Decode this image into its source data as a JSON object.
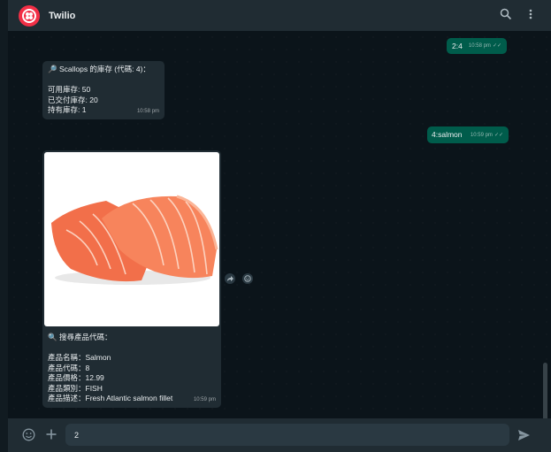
{
  "header": {
    "title": "Twilio"
  },
  "messages": {
    "m1": {
      "text": "2:4",
      "time": "10:58 pm"
    },
    "m2": {
      "text": "🔎 Scallops 的庫存 (代碼: 4)：\n\n可用庫存: 50\n已交付庫存: 20\n持有庫存: 1",
      "time": "10:58 pm"
    },
    "m3": {
      "text": "4:salmon",
      "time": "10:59 pm"
    },
    "m4": {
      "caption": "🔍 搜尋產品代碼：\n\n產品名稱：Salmon\n產品代碼：8\n產品價格：12.99\n產品類別：FISH\n產品描述：Fresh Atlantic salmon fillet",
      "time": "10:59 pm",
      "image": "salmon-fillet"
    }
  },
  "composer": {
    "value": "2"
  },
  "icons": {
    "header": [
      "search-icon",
      "menu-icon"
    ],
    "footer": [
      "emoji-icon",
      "plus-icon",
      "send-icon"
    ],
    "actions": [
      "forward-icon",
      "react-icon"
    ]
  },
  "colors": {
    "brand": "#f22f46",
    "outgoing": "#005c4b",
    "incoming": "#202c33"
  }
}
